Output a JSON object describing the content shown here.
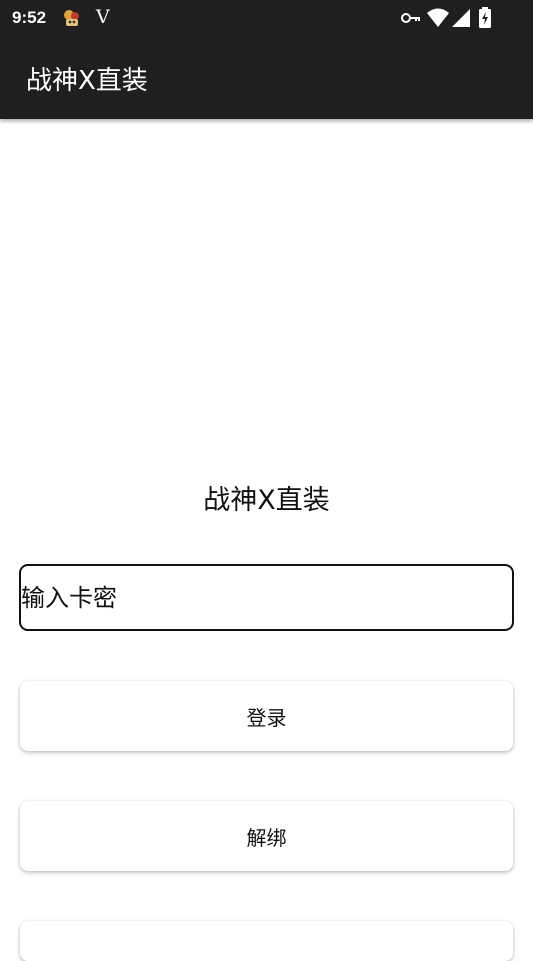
{
  "status_bar": {
    "time": "9:52",
    "extra_label": "V",
    "icons": [
      "app-notification-icon",
      "vpn-key-icon",
      "wifi-icon",
      "cell-signal-icon",
      "battery-charging-icon"
    ]
  },
  "app_bar": {
    "title": "战神X直装"
  },
  "main": {
    "heading": "战神X直装",
    "card_input": {
      "placeholder": "输入卡密",
      "value": ""
    },
    "login_button": "登录",
    "unbind_button": "解绑",
    "third_button": ""
  },
  "colors": {
    "bar_background": "#1f1f1f",
    "page_background": "#ffffff",
    "text": "#111111"
  }
}
